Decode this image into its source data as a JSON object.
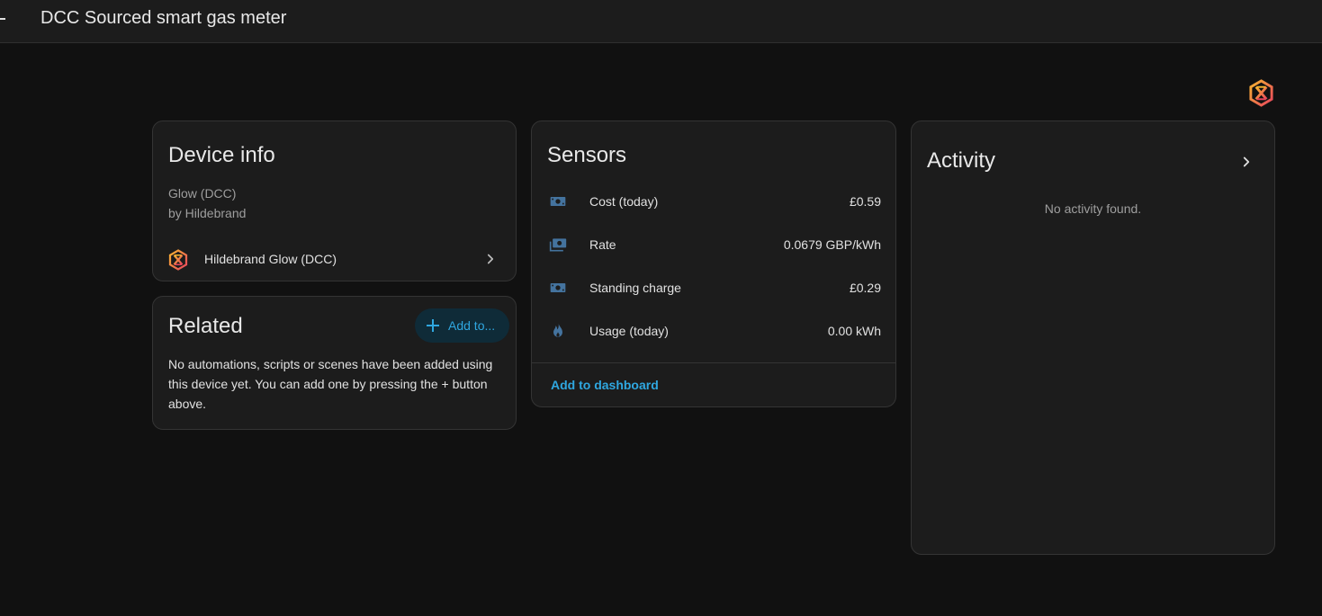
{
  "header": {
    "title": "DCC Sourced smart gas meter"
  },
  "device_info": {
    "title": "Device info",
    "model": "Glow (DCC)",
    "manufacturer": "by Hildebrand",
    "integration_label": "Hildebrand Glow (DCC)"
  },
  "related": {
    "title": "Related",
    "add_label": "Add to...",
    "description": "No automations, scripts or scenes have been added using this device yet. You can add one by pressing the + button above."
  },
  "sensors": {
    "title": "Sensors",
    "items": [
      {
        "name": "Cost (today)",
        "value": "£0.59",
        "icon": "cash-icon"
      },
      {
        "name": "Rate",
        "value": "0.0679 GBP/kWh",
        "icon": "cash-multiple-icon"
      },
      {
        "name": "Standing charge",
        "value": "£0.29",
        "icon": "cash-icon"
      },
      {
        "name": "Usage (today)",
        "value": "0.00 kWh",
        "icon": "fire-icon"
      }
    ],
    "add_to_dashboard": "Add to dashboard"
  },
  "activity": {
    "title": "Activity",
    "empty_text": "No activity found."
  },
  "colors": {
    "accent": "#2fa7e0",
    "icon": "#44739e",
    "background": "#111111",
    "card": "#1c1c1c"
  }
}
